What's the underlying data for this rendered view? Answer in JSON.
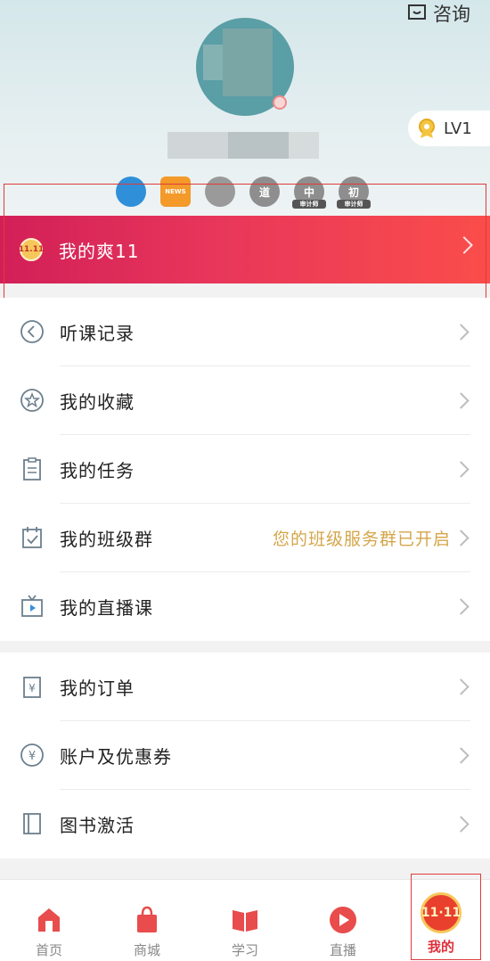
{
  "header": {
    "consult_label": "咨询",
    "level_label": "LV1"
  },
  "badges": [
    {
      "name": "badge-profile",
      "text": ""
    },
    {
      "name": "badge-news",
      "text": "NEWS"
    },
    {
      "name": "badge-flower",
      "text": ""
    },
    {
      "name": "badge-dao",
      "text": "道"
    },
    {
      "name": "badge-zhong",
      "text": "中",
      "sub": "审计师"
    },
    {
      "name": "badge-chu",
      "text": "初",
      "sub": "审计师"
    }
  ],
  "promo": {
    "icon_text": "11.11",
    "label": "我的爽11"
  },
  "section1": {
    "rows": [
      {
        "label": "听课记录",
        "icon": "history-icon"
      },
      {
        "label": "我的收藏",
        "icon": "star-icon"
      },
      {
        "label": "我的任务",
        "icon": "clipboard-icon"
      },
      {
        "label": "我的班级群",
        "icon": "calendar-check-icon",
        "extra": "您的班级服务群已开启"
      },
      {
        "label": "我的直播课",
        "icon": "tv-play-icon"
      }
    ]
  },
  "section2": {
    "rows": [
      {
        "label": "我的订单",
        "icon": "order-icon"
      },
      {
        "label": "账户及优惠券",
        "icon": "yuan-icon"
      },
      {
        "label": "图书激活",
        "icon": "book-icon"
      }
    ]
  },
  "tabbar": {
    "tabs": [
      {
        "label": "首页",
        "icon": "home-icon"
      },
      {
        "label": "商城",
        "icon": "shop-bag-icon"
      },
      {
        "label": "学习",
        "icon": "open-book-icon"
      },
      {
        "label": "直播",
        "icon": "play-circle-icon"
      },
      {
        "label": "我的",
        "icon": "double11-icon",
        "badge_text": "11·11"
      }
    ]
  },
  "colors": {
    "promo_start": "#d21f58",
    "promo_end": "#fa4d4a",
    "accent_text": "#d4a64a",
    "tab_active": "#e0303a",
    "header_bg": "#d4e7ea"
  }
}
